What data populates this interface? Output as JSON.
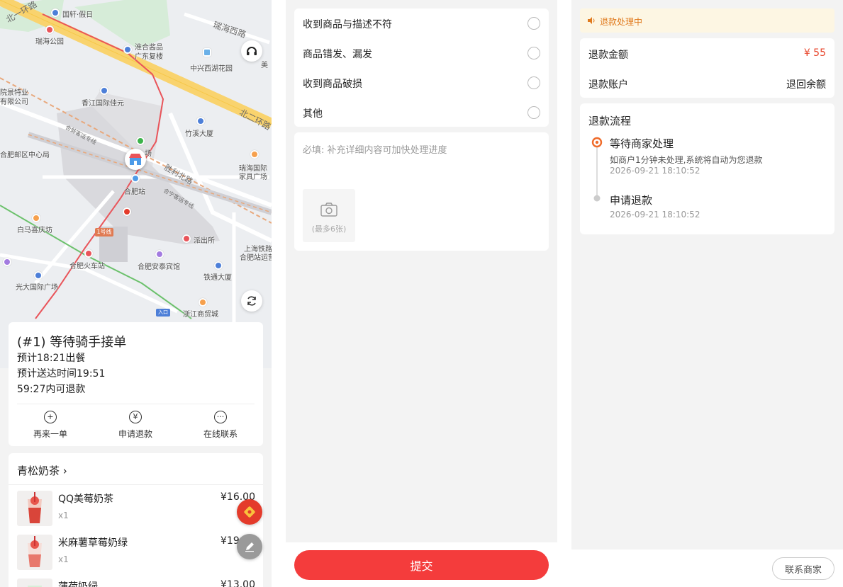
{
  "map": {
    "labels": {
      "guoxuan": "国轩·假日",
      "ruihai_park": "瑞海公园",
      "huaihe": "淮合酱品",
      "guangxia": "广东复楼",
      "zhongxing": "中兴西湖花园",
      "xiangjiang": "香江国际佳元",
      "zhuxi": "竹溪大厦",
      "hospital1": "院景特业",
      "hospital2": "有限公司",
      "post_office": "合肥邮区中心局",
      "ruihai_intl": "瑞海国际",
      "jiaju": "家具广场",
      "hefei_station": "合肥站",
      "baima": "白马喜庆坊",
      "paichusuo": "派出所",
      "shanghai_tielu": "上海铁路",
      "hefei_zhanyun": "合肥站运营",
      "huochezhan": "合肥火车站",
      "anying": "合肥安泰宾馆",
      "tietong": "铁通大厦",
      "guangda": "光大国际广场",
      "zhejiang": "浙江商贸城",
      "mei": "美",
      "chang": "场",
      "line1": "1号线",
      "exit": "入口"
    },
    "roads": {
      "beiyi": "北一环路",
      "ruihai_west": "瑞海西路",
      "beier": "北二环路",
      "shengli": "胜利北路",
      "hening": "合宁客运专线",
      "hefei_gaotie": "合蚌客运专线"
    }
  },
  "order": {
    "title": "(#1) 等待骑手接单",
    "line1": "预计18:21出餐",
    "line2": "预计送达时间19:51",
    "line3": "59:27内可退款",
    "actions": [
      {
        "label": "再来一单",
        "icon": "plus-circle-icon"
      },
      {
        "label": "申请退款",
        "icon": "yen-circle-icon"
      },
      {
        "label": "在线联系",
        "icon": "chat-dots-icon"
      }
    ]
  },
  "shop": {
    "name": "青松奶茶",
    "items": [
      {
        "name": "QQ美莓奶茶",
        "qty": "x1",
        "price": "¥16.00"
      },
      {
        "name": "米麻薯草莓奶绿",
        "qty": "x1",
        "price": "¥19.00"
      },
      {
        "name": "薄荷奶绿",
        "qty": "",
        "price": "¥13.00"
      }
    ]
  },
  "refund_form": {
    "reasons": [
      "收到商品与描述不符",
      "商品错发、漏发",
      "收到商品破损",
      "其他"
    ],
    "note_placeholder": "必填: 补充详细内容可加快处理进度",
    "upload_label": "(最多6张)",
    "submit_label": "提交"
  },
  "refund_status": {
    "notice": "退款处理中",
    "amount_label": "退款金额",
    "amount_value": "¥ 55",
    "account_label": "退款账户",
    "account_value": "退回余额",
    "flow_title": "退款流程",
    "steps": [
      {
        "title": "等待商家处理",
        "desc": "如商户1分钟未处理,系统将自动为您退款",
        "time": "2026-09-21 18:10:52"
      },
      {
        "title": "申请退款",
        "desc": "",
        "time": "2026-09-21 18:10:52"
      }
    ],
    "contact_label": "联系商家"
  },
  "colors": {
    "accent_red": "#f43c3c",
    "price_red": "#e8452b",
    "notice_bg": "#fdf6e3",
    "notice_text": "#e07a1e",
    "step_active": "#ef6b2a"
  }
}
